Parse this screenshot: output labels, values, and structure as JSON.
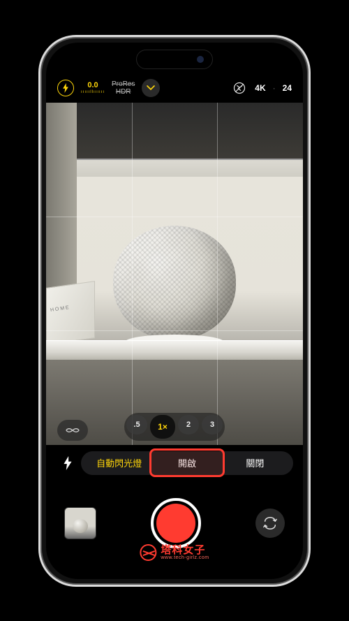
{
  "topbar": {
    "exposure_value": "0.0",
    "exposure_scale": "ıııııllıııııı",
    "prores_line1": "ProRes",
    "prores_line2": "HDR",
    "resolution": "4K",
    "separator": "·",
    "fps": "24"
  },
  "zoom": {
    "levels": [
      ".5",
      "1×",
      "2",
      "3"
    ],
    "active_index": 1
  },
  "flash_options": {
    "auto": "自動閃光燈",
    "on": "開啟",
    "off": "關閉"
  },
  "watermark": {
    "title": "塔科女子",
    "url": "www.tech-girlz.com"
  }
}
